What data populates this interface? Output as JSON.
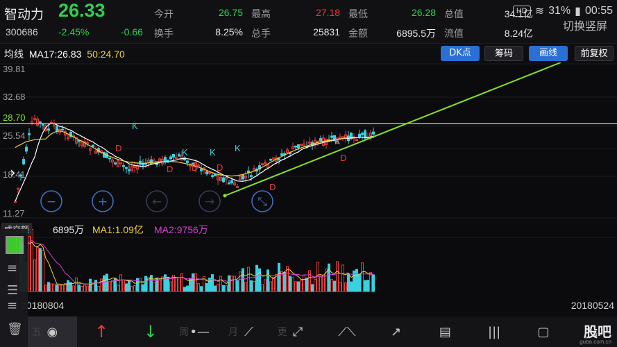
{
  "stock": {
    "name": "智动力",
    "price": "26.33",
    "code": "300686",
    "change_pct": "-2.45%",
    "change": "-0.66"
  },
  "quote_fields": {
    "open_label": "今开",
    "open": "26.75",
    "high_label": "最高",
    "high": "27.18",
    "low_label": "最低",
    "low": "26.28",
    "turnover_label": "换手",
    "turnover": "8.25%",
    "hands_label": "总手",
    "hands": "25831",
    "amount_label": "金额",
    "amount": "6895.5万",
    "float_label": "流值",
    "float": "8.24亿",
    "total_label": "总值",
    "total": "34.1亿"
  },
  "status_bar": {
    "hd": "HD",
    "battery": "31%",
    "time": "00:55"
  },
  "switch_label": "切换竖屏",
  "indicator": {
    "label": "均线",
    "ma17": "MA17:26.83",
    "ma50": "50:24.70"
  },
  "toolbar": {
    "dk": "DK点",
    "chips": "筹码",
    "draw": "画线",
    "adjust": "前复权"
  },
  "y_axis_labels": [
    "39.81",
    "32.68",
    "28.70",
    "25.54",
    "18.41",
    "11.27"
  ],
  "volume": {
    "tag": "成交额",
    "value": "6895万",
    "ma1": "MA1:1.09亿",
    "ma2": "MA2:9756万"
  },
  "dates": {
    "start": "20180804",
    "end": "20180524"
  },
  "bottom_tools": [
    {
      "name": "五",
      "icon": "eye-icon"
    },
    {
      "name": "up",
      "icon": "arrow-up-icon"
    },
    {
      "name": "down",
      "icon": "arrow-down-icon"
    },
    {
      "name": "周",
      "icon": "horizontal-line-icon"
    },
    {
      "name": "月",
      "icon": "segment-icon"
    },
    {
      "name": "更",
      "icon": "ray-icon"
    },
    {
      "name": "",
      "icon": "polyline-icon"
    },
    {
      "name": "",
      "icon": "diagonal-arrow-icon"
    },
    {
      "name": "",
      "icon": "fibonacci-icon"
    },
    {
      "name": "",
      "icon": "bars-icon"
    },
    {
      "name": "",
      "icon": "rectangle-icon"
    },
    {
      "name": "",
      "icon": "expand-icon"
    }
  ],
  "watermark": {
    "text": "股吧",
    "sub": "guba.com.cn"
  },
  "colors": {
    "up": "#e83a3a",
    "down": "#2fcf52",
    "ma_white": "#ffffff",
    "ma_yellow": "#f2d23a",
    "ma_purple": "#d83fd8",
    "trendline": "#86e02a"
  }
}
